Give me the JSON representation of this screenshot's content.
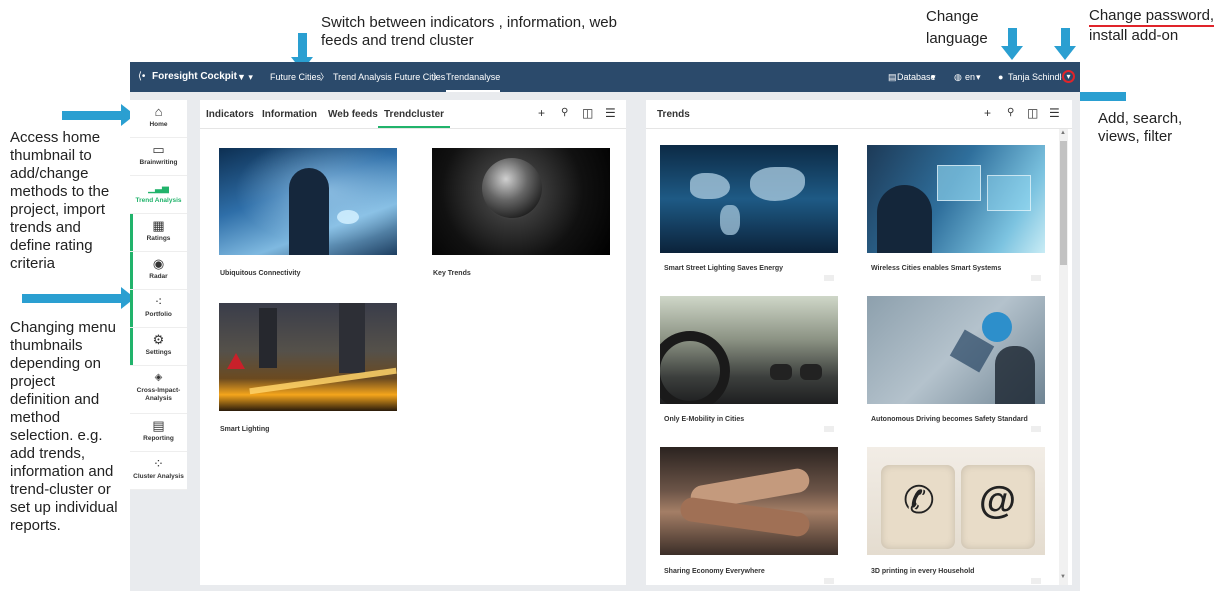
{
  "annotations": {
    "top_center": [
      "Switch between indicators , information, web",
      "feeds and trend cluster"
    ],
    "change_language": [
      "Change",
      "language"
    ],
    "change_password": [
      "Change password,",
      "install add-on"
    ],
    "add_search": [
      "Add, search,",
      "views, filter"
    ],
    "left_home": [
      "Access home",
      "thumbnail to",
      "add/change",
      "methods to the",
      "project, import",
      "trends and",
      "define rating",
      "criteria"
    ],
    "left_menu": [
      "Changing menu",
      "thumbnails",
      "depending on",
      "project",
      "definition and",
      "method",
      "selection. e.g.",
      "add trends,",
      "information and",
      "trend-cluster or",
      "set up individual",
      "reports."
    ]
  },
  "topbar": {
    "brand": "Foresight Cockpit",
    "breadcrumbs": [
      "Future Cities",
      "Trend Analysis Future Cities",
      "Trendanalyse"
    ],
    "database": "Database",
    "language": "en",
    "user": "Tanja Schindler"
  },
  "sidebar": [
    {
      "label": "Home",
      "icon": "home-icon",
      "glyph": "⌂"
    },
    {
      "label": "Brainwriting",
      "icon": "brainwriting-icon",
      "glyph": "▭"
    },
    {
      "label": "Trend Analysis",
      "icon": "trend-chart-icon",
      "glyph": "▁▃▅"
    },
    {
      "label": "Ratings",
      "icon": "grid-icon",
      "glyph": "▦"
    },
    {
      "label": "Radar",
      "icon": "radar-icon",
      "glyph": "◉"
    },
    {
      "label": "Portfolio",
      "icon": "scatter-icon",
      "glyph": "⁖"
    },
    {
      "label": "Settings",
      "icon": "gears-icon",
      "glyph": "⚙"
    },
    {
      "label": "Cross-Impact-Analysis",
      "icon": "cross-impact-icon",
      "glyph": "◈"
    },
    {
      "label": "Reporting",
      "icon": "report-icon",
      "glyph": "▤"
    },
    {
      "label": "Cluster Analysis",
      "icon": "cluster-icon",
      "glyph": "⁘"
    }
  ],
  "left_panel": {
    "tabs": [
      "Indicators",
      "Information",
      "Web feeds",
      "Trendcluster"
    ],
    "active_tab": "Trendcluster",
    "cards": [
      "Ubiquitous Connectivity",
      "Key Trends",
      "Smart Lighting"
    ]
  },
  "right_panel": {
    "title": "Trends",
    "cards": [
      "Smart Street Lighting Saves Energy",
      "Wireless Cities enables Smart Systems",
      "Only E-Mobility in Cities",
      "Autonomous Driving becomes Safety Standard",
      "Sharing Economy Everywhere",
      "3D printing in every Household"
    ]
  },
  "colors": {
    "topbar": "#2b4a6b",
    "accent_green": "#21b36b",
    "arrow_blue": "#2a9fd1",
    "underline_red": "#e0242a"
  }
}
